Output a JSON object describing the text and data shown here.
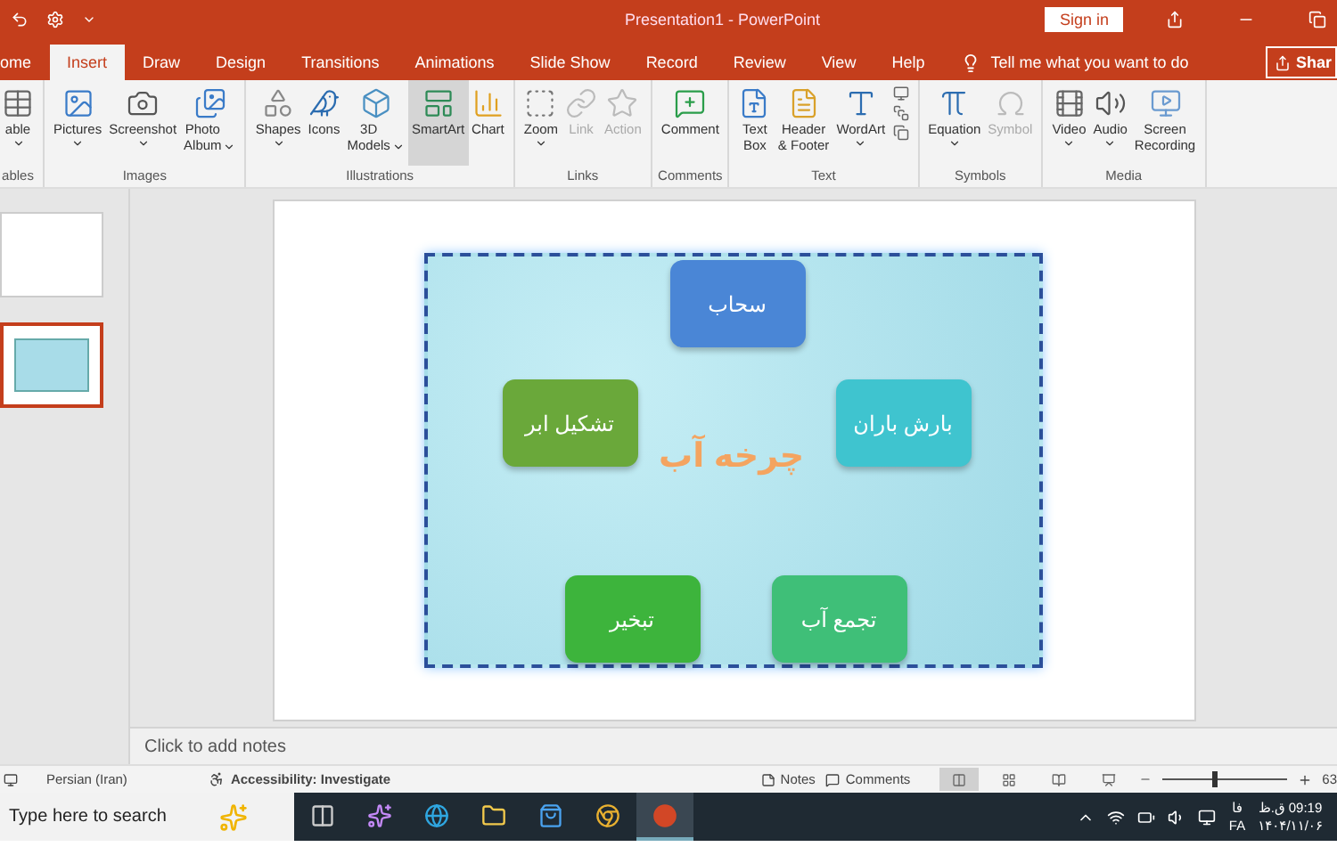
{
  "title_bar": {
    "title": "Presentation1  -  PowerPoint",
    "sign_in": "Sign in"
  },
  "tabs": [
    {
      "label": "ome",
      "selected": false
    },
    {
      "label": "Insert",
      "selected": true
    },
    {
      "label": "Draw",
      "selected": false
    },
    {
      "label": "Design",
      "selected": false
    },
    {
      "label": "Transitions",
      "selected": false
    },
    {
      "label": "Animations",
      "selected": false
    },
    {
      "label": "Slide Show",
      "selected": false
    },
    {
      "label": "Record",
      "selected": false
    },
    {
      "label": "Review",
      "selected": false
    },
    {
      "label": "View",
      "selected": false
    },
    {
      "label": "Help",
      "selected": false
    }
  ],
  "tell_me": "Tell me what you want to do",
  "share": "Shar",
  "ribbon_groups": [
    {
      "label": "ables",
      "buttons": [
        {
          "kind": "table",
          "label": "able",
          "dropdown": true,
          "disabled": false,
          "highlighted": false
        }
      ]
    },
    {
      "label": "Images",
      "buttons": [
        {
          "kind": "pictures",
          "label": "Pictures",
          "dropdown": true,
          "disabled": false,
          "highlighted": false
        },
        {
          "kind": "screenshot",
          "label": "Screenshot",
          "dropdown": true,
          "disabled": false,
          "highlighted": false
        },
        {
          "kind": "album",
          "label": "Photo\nAlbum",
          "dropdown": true,
          "disabled": false,
          "highlighted": false
        }
      ]
    },
    {
      "label": "Illustrations",
      "buttons": [
        {
          "kind": "shapes",
          "label": "Shapes",
          "dropdown": true,
          "disabled": false,
          "highlighted": false
        },
        {
          "kind": "icons",
          "label": "Icons",
          "dropdown": false,
          "disabled": false,
          "highlighted": false
        },
        {
          "kind": "models",
          "label": "3D\nModels",
          "dropdown": true,
          "disabled": false,
          "highlighted": false
        },
        {
          "kind": "smartart",
          "label": "SmartArt",
          "dropdown": false,
          "disabled": false,
          "highlighted": true
        },
        {
          "kind": "chart",
          "label": "Chart",
          "dropdown": false,
          "disabled": false,
          "highlighted": false
        }
      ]
    },
    {
      "label": "Links",
      "buttons": [
        {
          "kind": "zoom",
          "label": "Zoom",
          "dropdown": true,
          "disabled": false,
          "highlighted": false
        },
        {
          "kind": "link",
          "label": "Link",
          "dropdown": false,
          "disabled": true,
          "highlighted": false
        },
        {
          "kind": "action",
          "label": "Action",
          "dropdown": false,
          "disabled": true,
          "highlighted": false
        }
      ]
    },
    {
      "label": "Comments",
      "buttons": [
        {
          "kind": "comment",
          "label": "Comment",
          "dropdown": false,
          "disabled": false,
          "highlighted": false
        }
      ]
    },
    {
      "label": "Text",
      "buttons": [
        {
          "kind": "textbox",
          "label": "Text\nBox",
          "dropdown": false,
          "disabled": false,
          "highlighted": false
        },
        {
          "kind": "header",
          "label": "Header\n& Footer",
          "dropdown": false,
          "disabled": false,
          "highlighted": false
        },
        {
          "kind": "wordart",
          "label": "WordArt",
          "dropdown": true,
          "disabled": false,
          "highlighted": false
        },
        {
          "kind": "stack"
        }
      ]
    },
    {
      "label": "Symbols",
      "buttons": [
        {
          "kind": "equation",
          "label": "Equation",
          "dropdown": true,
          "disabled": false,
          "highlighted": false
        },
        {
          "kind": "symbol",
          "label": "Symbol",
          "dropdown": false,
          "disabled": true,
          "highlighted": false
        }
      ]
    },
    {
      "label": "Media",
      "buttons": [
        {
          "kind": "video",
          "label": "Video",
          "dropdown": true,
          "disabled": false,
          "highlighted": false
        },
        {
          "kind": "audio",
          "label": "Audio",
          "dropdown": true,
          "disabled": false,
          "highlighted": false
        },
        {
          "kind": "recording",
          "label": "Screen\nRecording",
          "dropdown": false,
          "disabled": false,
          "highlighted": false
        }
      ]
    }
  ],
  "thumbnails": [
    {
      "selected": false
    },
    {
      "selected": true
    }
  ],
  "slide": {
    "title": "چرخه آب",
    "nodes": [
      {
        "label": "سحاب",
        "color": "#4a86d6"
      },
      {
        "label": "تشکیل ابر",
        "color": "#6aa83a"
      },
      {
        "label": "بارش باران",
        "color": "#3fc4cf"
      },
      {
        "label": "تبخیر",
        "color": "#3db43c"
      },
      {
        "label": "تجمع آب",
        "color": "#3fbf78"
      }
    ]
  },
  "notes_placeholder": "Click to add notes",
  "status_bar": {
    "language": "Persian (Iran)",
    "accessibility": "Accessibility: Investigate",
    "notes": "Notes",
    "comments": "Comments",
    "views": [
      {
        "kind": "normal",
        "selected": true
      },
      {
        "kind": "sorter",
        "selected": false
      },
      {
        "kind": "reading",
        "selected": false
      },
      {
        "kind": "show",
        "selected": false
      }
    ],
    "zoom": {
      "level": 0.4,
      "reading": "63"
    }
  },
  "taskbar": {
    "search_placeholder": "Type here to search",
    "apps": [
      {
        "kind": "taskview",
        "selected": false
      },
      {
        "kind": "copilot",
        "selected": false
      },
      {
        "kind": "edge",
        "selected": false
      },
      {
        "kind": "files",
        "selected": false
      },
      {
        "kind": "store",
        "selected": false
      },
      {
        "kind": "chrome",
        "selected": false
      },
      {
        "kind": "powerpoint",
        "selected": true
      }
    ],
    "language": "فا",
    "language_code": "FA",
    "time": "09:19 ق.ظ",
    "date": "۱۴۰۴/۱۱/۰۶"
  }
}
